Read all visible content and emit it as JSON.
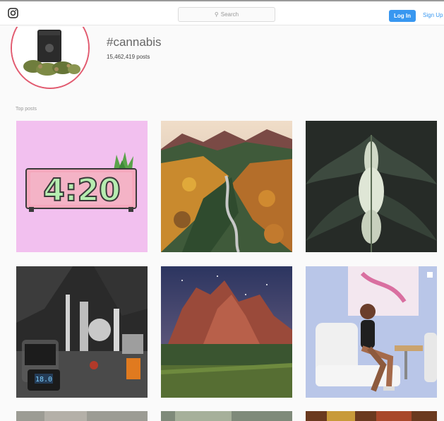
{
  "header": {
    "search_placeholder": "Search",
    "login_label": "Log In",
    "signup_label": "Sign Up"
  },
  "profile": {
    "hashtag": "#cannabis",
    "posts_count": "15,462,419 posts"
  },
  "top_posts": {
    "label": "Top posts",
    "tiles": [
      {
        "name": "clock-420-post",
        "clock_text": "4:20"
      },
      {
        "name": "mountain-valley-post"
      },
      {
        "name": "cannabis-plant-post"
      },
      {
        "name": "lab-equipment-post",
        "scale_readout": "18.0"
      },
      {
        "name": "red-rocks-post"
      },
      {
        "name": "woman-chair-post"
      }
    ]
  },
  "colors": {
    "accent_blue": "#3897f0",
    "avatar_ring": "#e25b70",
    "clock_pink": "#f2c0ef"
  }
}
